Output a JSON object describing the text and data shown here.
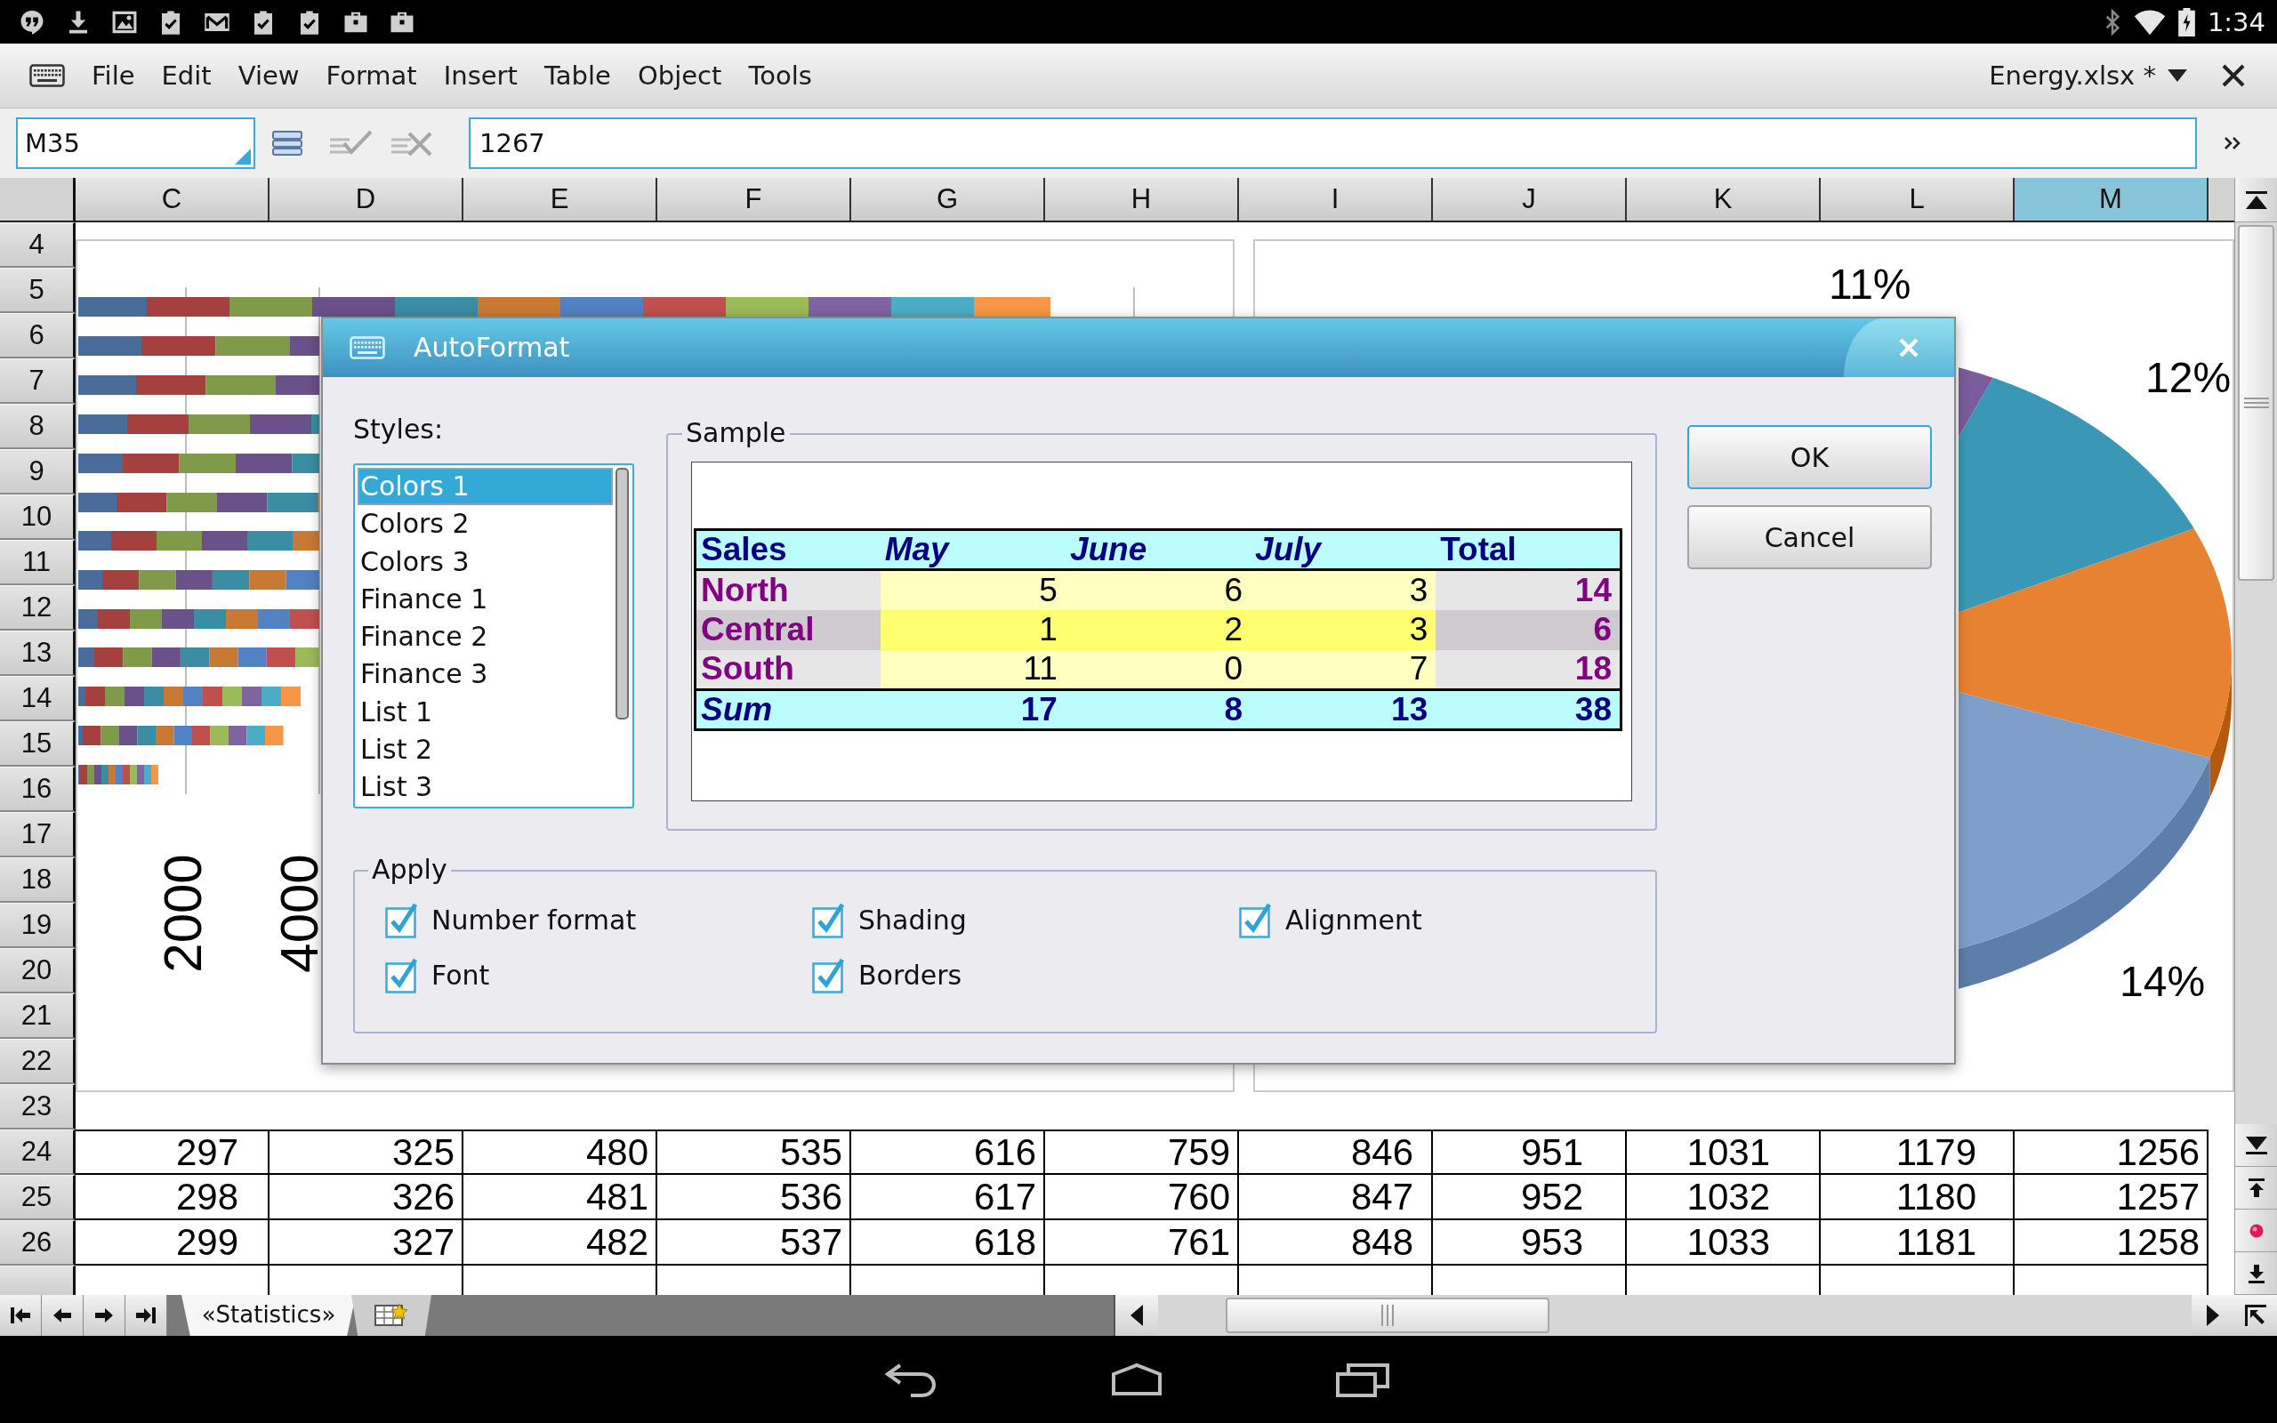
{
  "status_bar": {
    "time": "1:34"
  },
  "menu_bar": {
    "items": [
      "File",
      "Edit",
      "View",
      "Format",
      "Insert",
      "Table",
      "Object",
      "Tools"
    ],
    "document": "Energy.xlsx *"
  },
  "formula_bar": {
    "cell_reference": "M35",
    "value": "1267"
  },
  "sheet": {
    "columns": [
      {
        "label": "C",
        "selected": false
      },
      {
        "label": "D",
        "selected": false
      },
      {
        "label": "E",
        "selected": false
      },
      {
        "label": "F",
        "selected": false
      },
      {
        "label": "G",
        "selected": false
      },
      {
        "label": "H",
        "selected": false
      },
      {
        "label": "I",
        "selected": false
      },
      {
        "label": "J",
        "selected": false
      },
      {
        "label": "K",
        "selected": false
      },
      {
        "label": "L",
        "selected": false
      },
      {
        "label": "M",
        "selected": true
      }
    ],
    "rows": [
      {
        "number": "4",
        "selected": false
      },
      {
        "number": "5",
        "selected": false
      },
      {
        "number": "6",
        "selected": false
      },
      {
        "number": "7",
        "selected": false
      },
      {
        "number": "8",
        "selected": false
      },
      {
        "number": "9",
        "selected": false
      },
      {
        "number": "10",
        "selected": false
      },
      {
        "number": "11",
        "selected": false
      },
      {
        "number": "12",
        "selected": false
      },
      {
        "number": "13",
        "selected": false
      },
      {
        "number": "14",
        "selected": false
      },
      {
        "number": "15",
        "selected": false
      },
      {
        "number": "16",
        "selected": false
      },
      {
        "number": "17",
        "selected": false
      },
      {
        "number": "18",
        "selected": false
      },
      {
        "number": "19",
        "selected": false
      },
      {
        "number": "20",
        "selected": false
      },
      {
        "number": "21",
        "selected": false
      },
      {
        "number": "22",
        "selected": false
      },
      {
        "number": "23",
        "selected": false
      },
      {
        "number": "24",
        "selected": false,
        "cells": [
          "297",
          "325",
          "480",
          "535",
          "616",
          "759",
          "846",
          "951",
          "1031",
          "1179",
          "1256"
        ]
      },
      {
        "number": "25",
        "selected": false,
        "cells": [
          "298",
          "326",
          "481",
          "536",
          "617",
          "760",
          "847",
          "952",
          "1032",
          "1180",
          "1257"
        ]
      },
      {
        "number": "26",
        "selected": false,
        "cells": [
          "299",
          "327",
          "482",
          "537",
          "618",
          "761",
          "848",
          "953",
          "1033",
          "1181",
          "1258"
        ]
      }
    ]
  },
  "bar_chart": {
    "axis_labels": [
      "2000",
      "4000"
    ]
  },
  "pie_chart": {
    "labels": [
      "11%",
      "12%",
      "14%"
    ]
  },
  "sheet_tabs": [
    {
      "label": "«Statistics»",
      "selected": true
    }
  ],
  "dialog": {
    "title": "AutoFormat",
    "styles": {
      "label": "Styles:",
      "items": [
        {
          "label": "Colors 1",
          "selected": true
        },
        {
          "label": "Colors 2",
          "selected": false
        },
        {
          "label": "Colors 3",
          "selected": false
        },
        {
          "label": "Finance 1",
          "selected": false
        },
        {
          "label": "Finance 2",
          "selected": false
        },
        {
          "label": "Finance 3",
          "selected": false
        },
        {
          "label": "List 1",
          "selected": false
        },
        {
          "label": "List 2",
          "selected": false
        },
        {
          "label": "List 3",
          "selected": false
        }
      ]
    },
    "sample": {
      "label": "Sample",
      "columns": [
        "Sales",
        "May",
        "June",
        "July",
        "Total"
      ],
      "rows": [
        {
          "label": "North",
          "values": [
            "5",
            "6",
            "3"
          ],
          "total": "14"
        },
        {
          "label": "Central",
          "values": [
            "1",
            "2",
            "3"
          ],
          "total": "6"
        },
        {
          "label": "South",
          "values": [
            "11",
            "0",
            "7"
          ],
          "total": "18"
        }
      ],
      "sum_row": {
        "label": "Sum",
        "values": [
          "17",
          "8",
          "13"
        ],
        "total": "38"
      }
    },
    "apply": {
      "label": "Apply",
      "options": [
        {
          "label": "Number format",
          "checked": true
        },
        {
          "label": "Shading",
          "checked": true
        },
        {
          "label": "Alignment",
          "checked": true
        },
        {
          "label": "Font",
          "checked": true
        },
        {
          "label": "Borders",
          "checked": true
        }
      ]
    },
    "buttons": [
      {
        "label": "OK",
        "focused": true
      },
      {
        "label": "Cancel",
        "focused": false
      }
    ]
  }
}
